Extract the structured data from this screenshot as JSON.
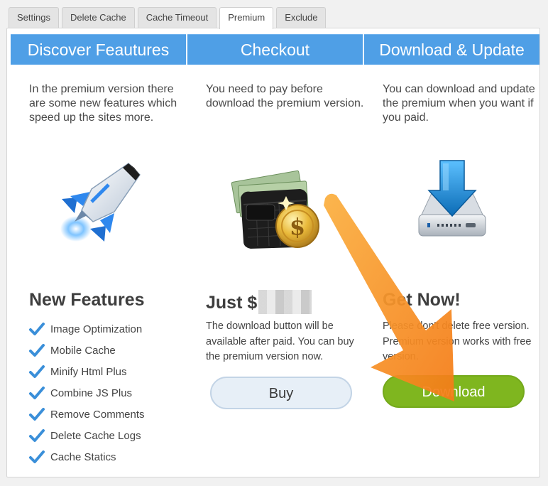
{
  "tabs": [
    {
      "label": "Settings",
      "active": false
    },
    {
      "label": "Delete Cache",
      "active": false
    },
    {
      "label": "Cache Timeout",
      "active": false
    },
    {
      "label": "Premium",
      "active": true
    },
    {
      "label": "Exclude",
      "active": false
    }
  ],
  "columns": {
    "discover": {
      "heading": "Discover Feautures",
      "text": "In the premium version there are some new features which speed up the sites more.",
      "image_icon": "rocket-icon",
      "subtitle": "New Features",
      "features": [
        "Image Optimization",
        "Mobile Cache",
        "Minify Html Plus",
        "Combine JS Plus",
        "Remove Comments",
        "Delete Cache Logs",
        "Cache Statics"
      ]
    },
    "checkout": {
      "heading": "Checkout",
      "text": "You need to pay before download the premium version.",
      "image_icon": "wallet-coin-icon",
      "subtitle_prefix": "Just $",
      "subtext": "The download button will be available after paid. You can buy the premium version now.",
      "button_label": "Buy"
    },
    "download": {
      "heading": "Download & Update",
      "text": "You can download and update the premium when you want if you paid.",
      "image_icon": "download-drive-icon",
      "subtitle": "Get Now!",
      "subtext": "Please don't delete free version. Premium version works with free version.",
      "button_label": "Download"
    }
  },
  "colors": {
    "header_blue": "#4f9fe6",
    "buy_bg": "#e7eff7",
    "download_green": "#7fb61f",
    "annotation_orange": "#f7941d"
  }
}
